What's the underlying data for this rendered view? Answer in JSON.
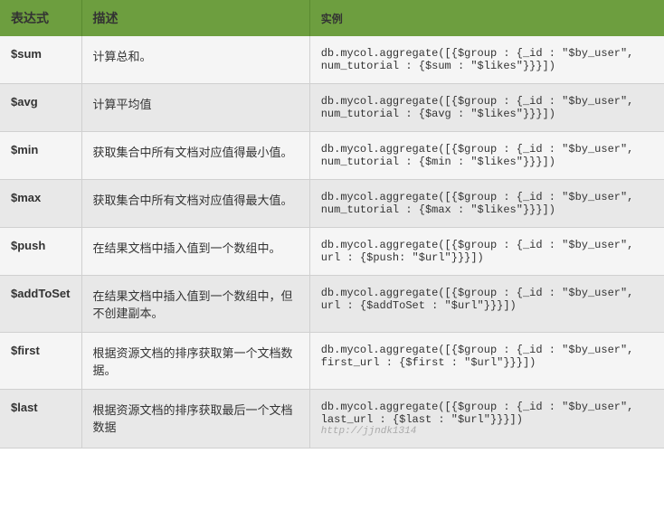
{
  "table": {
    "headers": {
      "expression": "表达式",
      "description": "描述",
      "example": "实例"
    },
    "rows": [
      {
        "expression": "$sum",
        "description": "计算总和。",
        "example_lines": [
          "db.mycol.aggregate([{$group : {_id : \"$by_user\",",
          "num_tutorial : {$sum : \"$likes\"}}}])"
        ]
      },
      {
        "expression": "$avg",
        "description": "计算平均值",
        "example_lines": [
          "db.mycol.aggregate([{$group : {_id : \"$by_user\",",
          "num_tutorial : {$avg : \"$likes\"}}}])"
        ]
      },
      {
        "expression": "$min",
        "description": "获取集合中所有文档对应值得最小值。",
        "example_lines": [
          "db.mycol.aggregate([{$group : {_id : \"$by_user\",",
          "num_tutorial : {$min : \"$likes\"}}}])"
        ]
      },
      {
        "expression": "$max",
        "description": "获取集合中所有文档对应值得最大值。",
        "example_lines": [
          "db.mycol.aggregate([{$group : {_id : \"$by_user\",",
          "num_tutorial : {$max : \"$likes\"}}}])"
        ]
      },
      {
        "expression": "$push",
        "description": "在结果文档中插入值到一个数组中。",
        "example_lines": [
          "db.mycol.aggregate([{$group : {_id : \"$by_user\",",
          "url : {$push: \"$url\"}}}])"
        ]
      },
      {
        "expression": "$addToSet",
        "description": "在结果文档中插入值到一个数组中，但不创建副本。",
        "example_lines": [
          "db.mycol.aggregate([{$group : {_id : \"$by_user\",",
          "url : {$addToSet : \"$url\"}}}])"
        ]
      },
      {
        "expression": "$first",
        "description": "根据资源文档的排序获取第一个文档数据。",
        "example_lines": [
          "db.mycol.aggregate([{$group : {_id : \"$by_user\",",
          "first_url : {$first : \"$url\"}}}])"
        ]
      },
      {
        "expression": "$last",
        "description": "根据资源文档的排序获取最后一个文档数据",
        "example_lines": [
          "db.mycol.aggregate([{$group : {_id : \"$by_user\",",
          "last_url : {$last : \"$url\"}}}])"
        ]
      }
    ],
    "watermark": "http://jjndk1314"
  }
}
